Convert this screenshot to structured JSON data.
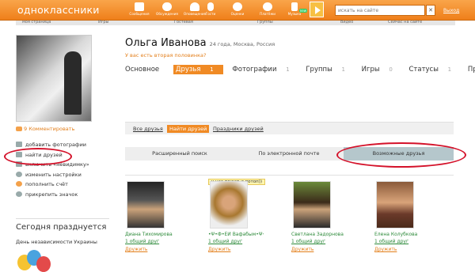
{
  "header": {
    "logo": "одноклассники",
    "nav": [
      {
        "label": "Сообщения",
        "icon": "envelope-icon"
      },
      {
        "label": "Обсуждения",
        "icon": "speech-bubbles-icon"
      },
      {
        "label": "Оповещения",
        "icon": "bell-icon"
      },
      {
        "label": "Гости",
        "icon": "footprints-icon"
      },
      {
        "label": "Оценки",
        "icon": "rating-icon"
      },
      {
        "label": "Платёжи",
        "icon": "coin-icon"
      },
      {
        "label": "Музыка",
        "icon": "music-note-icon",
        "badge": "new"
      }
    ],
    "search_placeholder": "искать на сайте",
    "exit_label": "Выход"
  },
  "subtabs": [
    "моя страница",
    "Игры",
    "Гостевая",
    "Группы",
    "Видео",
    "Сейчас на сайте"
  ],
  "sidebar": {
    "comment_link": "9 Комментировать",
    "menu": [
      {
        "label": "добавить фотографии",
        "icon": "camera-icon"
      },
      {
        "label": "найти друзей",
        "icon": "person-icon"
      },
      {
        "label": "включить «невидимку»",
        "icon": "invisible-icon"
      },
      {
        "label": "изменить настройки",
        "icon": "gear-icon"
      },
      {
        "label": "пополнить счёт",
        "icon": "coins-icon"
      },
      {
        "label": "прикрепить значок",
        "icon": "pin-icon"
      }
    ],
    "today_title": "Сегодня празднуется",
    "holiday": "День независимости Украины"
  },
  "profile": {
    "name": "Ольга Иванова",
    "info": "24 года, Москва, Россия",
    "relation_link": "У вас есть вторая половинка?",
    "tabs": [
      {
        "label": "Основное",
        "count": ""
      },
      {
        "label": "Друзья",
        "count": "1"
      },
      {
        "label": "Фотографии",
        "count": "1"
      },
      {
        "label": "Группы",
        "count": "1"
      },
      {
        "label": "Игры",
        "count": "0"
      },
      {
        "label": "Статусы",
        "count": "1"
      },
      {
        "label": "Прочее ▾",
        "count": ""
      }
    ]
  },
  "friends_bar": [
    "Все друзья",
    "Найти друзей",
    "Праздники друзей"
  ],
  "search_tabs": [
    "Расширенный поиск",
    "По электронной почте",
    "Возможные друзья"
  ],
  "photo_tag": "у нас пожар и потоп))",
  "friends": [
    {
      "name": "Диана Тихомирова",
      "mutual": "1 общий друг",
      "add": "Дружить"
    },
    {
      "name": "•Ψ•Ф•ЕЙ Вафабым•Ψ•Ф•",
      "mutual": "1 общий друг",
      "add": "Дружить"
    },
    {
      "name": "Светлана Задорнова",
      "mutual": "1 общий друг",
      "add": "Дружить"
    },
    {
      "name": "Елена Колубкова",
      "mutual": "1 общий друг",
      "add": "Дружить"
    }
  ],
  "colors": {
    "brand": "#f08a24",
    "link_green": "#2d8a3a",
    "highlight_oval": "#d4122a"
  }
}
